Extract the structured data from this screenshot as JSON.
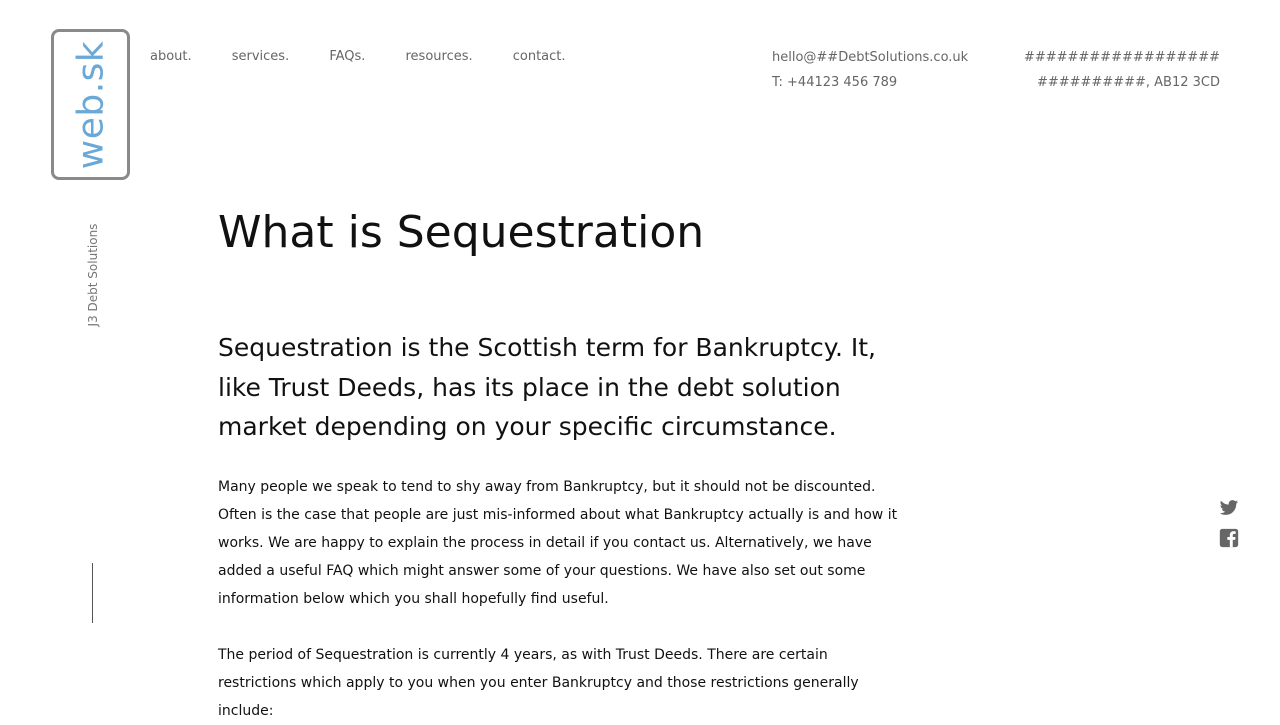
{
  "brand": {
    "logo_text": "web.sk",
    "tagline": "J3 Debt Solutions"
  },
  "nav": {
    "items": [
      {
        "label": "about."
      },
      {
        "label": "services."
      },
      {
        "label": "FAQs."
      },
      {
        "label": "resources."
      },
      {
        "label": "contact."
      }
    ]
  },
  "contact": {
    "email": "hello@##DebtSolutions.co.uk",
    "phone": "T: +44123 456 789"
  },
  "address": {
    "line1": "##################",
    "line2": "##########, AB12 3CD"
  },
  "main": {
    "title": "What is Sequestration",
    "lead": "Sequestration is the Scottish term for Bankruptcy. It, like Trust Deeds, has its place in the debt solution market depending on your specific circumstance.",
    "paragraphs": [
      "Many people we speak to tend to shy away from Bankruptcy, but it should not be discounted. Often is the case that people are just mis-informed about what Bankruptcy actually is and how it works. We are happy to explain the process in detail if you contact us. Alternatively, we have added a useful FAQ which might answer some of your questions. We have also set out some information below which you shall hopefully find useful.",
      "The period of Sequestration is currently 4 years, as with Trust Deeds. There are certain restrictions which apply to you when you enter Bankruptcy and those restrictions generally include:"
    ]
  },
  "social": {
    "icons": [
      "twitter-icon",
      "facebook-icon"
    ]
  },
  "colors": {
    "logo_blue": "#6aa8d8",
    "logo_border": "#8a8a8a",
    "muted_text": "#666666",
    "body_text": "#111111"
  }
}
